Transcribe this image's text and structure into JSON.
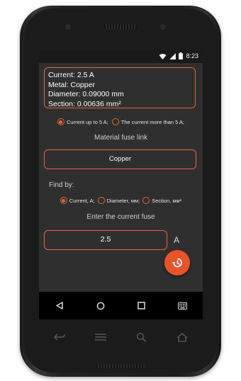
{
  "status_bar": {
    "time": "8:23"
  },
  "result": {
    "lines": [
      "Current: 2.5 A",
      "Metal: Copper",
      "Diameter: 0.09000 mm",
      "Section: 0.00636 mm²"
    ]
  },
  "current_range": {
    "options": [
      {
        "label": "Current up to 5 A;",
        "selected": true
      },
      {
        "label": "The current more than 5 A;",
        "selected": false
      }
    ]
  },
  "material": {
    "label": "Material fuse link",
    "value": "Copper"
  },
  "find_by": {
    "label": "Find by:",
    "options": [
      {
        "label": "Current, A;",
        "selected": true
      },
      {
        "label": "Diameter, мм;",
        "selected": false
      },
      {
        "label": "Section, мм²",
        "selected": false
      }
    ]
  },
  "input": {
    "label": "Enter the current fuse",
    "value": "2.5",
    "unit": "A"
  },
  "fab": {
    "icon": "history-icon"
  },
  "nav_bar": {
    "icons": [
      "back-icon",
      "home-icon",
      "recents-icon",
      "keyboard-icon"
    ]
  },
  "hardware_keys": {
    "icons": [
      "back-hw-icon",
      "menu-hw-icon",
      "search-hw-icon",
      "home-hw-icon"
    ]
  },
  "colors": {
    "accent": "#e86532",
    "fab": "#e8542a",
    "screen_bg": "#2f2f2f"
  }
}
